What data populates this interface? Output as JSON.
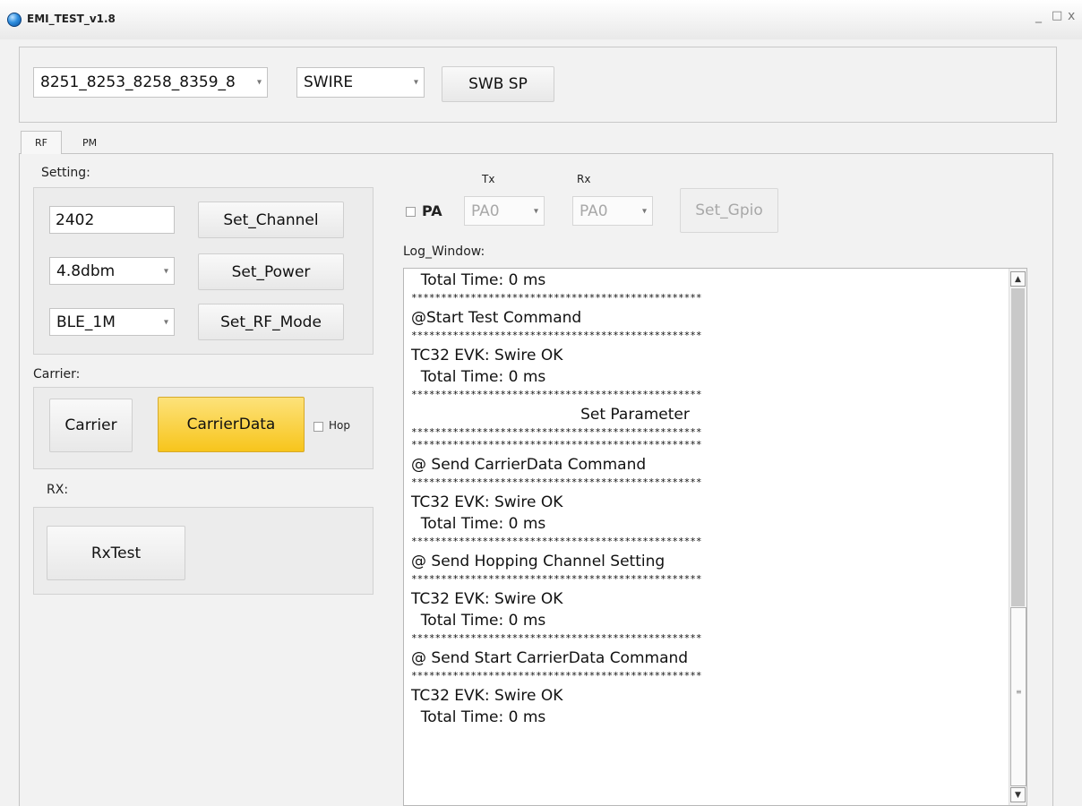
{
  "window": {
    "title": "EMI_TEST_v1.8",
    "controls": [
      "_",
      "□",
      "x"
    ]
  },
  "connection": {
    "chip_select": "8251_8253_8258_8359_8",
    "interface_select": "SWIRE",
    "swb_sp_label": "SWB SP"
  },
  "tabs": [
    "RF",
    "PM"
  ],
  "setting": {
    "title": "Setting:",
    "channel_value": "2402",
    "set_channel_label": "Set_Channel",
    "power_select": "4.8dbm",
    "set_power_label": "Set_Power",
    "rf_mode_select": "BLE_1M",
    "set_rf_mode_label": "Set_RF_Mode"
  },
  "carrier": {
    "title": "Carrier:",
    "carrier_label": "Carrier",
    "carrier_data_label": "CarrierData",
    "hop_label": "Hop"
  },
  "rx": {
    "title": "RX:",
    "rxtest_label": "RxTest"
  },
  "gpio": {
    "pa_label": "PA",
    "tx_label": "Tx",
    "rx_label": "Rx",
    "tx_select": "PA0",
    "rx_select": "PA0",
    "set_gpio_label": "Set_Gpio"
  },
  "log": {
    "title": "Log_Window:",
    "lines": [
      {
        "text": "  Total Time: 0 ms",
        "kind": "text"
      },
      {
        "text": "*************************************************",
        "kind": "stars"
      },
      {
        "text": "@Start Test Command",
        "kind": "text"
      },
      {
        "text": "*************************************************",
        "kind": "stars"
      },
      {
        "text": "TC32 EVK: Swire OK",
        "kind": "text"
      },
      {
        "text": "  Total Time: 0 ms",
        "kind": "text"
      },
      {
        "text": "*************************************************",
        "kind": "stars"
      },
      {
        "text": "Set Parameter",
        "kind": "center"
      },
      {
        "text": "*************************************************",
        "kind": "stars"
      },
      {
        "text": "*************************************************",
        "kind": "stars"
      },
      {
        "text": "@ Send CarrierData Command",
        "kind": "text"
      },
      {
        "text": "*************************************************",
        "kind": "stars"
      },
      {
        "text": "TC32 EVK: Swire OK",
        "kind": "text"
      },
      {
        "text": "  Total Time: 0 ms",
        "kind": "text"
      },
      {
        "text": "*************************************************",
        "kind": "stars"
      },
      {
        "text": "@ Send Hopping Channel Setting",
        "kind": "text"
      },
      {
        "text": "*************************************************",
        "kind": "stars"
      },
      {
        "text": "TC32 EVK: Swire OK",
        "kind": "text"
      },
      {
        "text": "  Total Time: 0 ms",
        "kind": "text"
      },
      {
        "text": "*************************************************",
        "kind": "stars"
      },
      {
        "text": "@ Send Start CarrierData Command",
        "kind": "text"
      },
      {
        "text": "*************************************************",
        "kind": "stars"
      },
      {
        "text": "TC32 EVK: Swire OK",
        "kind": "text"
      },
      {
        "text": "  Total Time: 0 ms",
        "kind": "text"
      }
    ]
  },
  "colors": {
    "active_button": "#f7c51c",
    "window_bg": "#f2f2f2"
  }
}
